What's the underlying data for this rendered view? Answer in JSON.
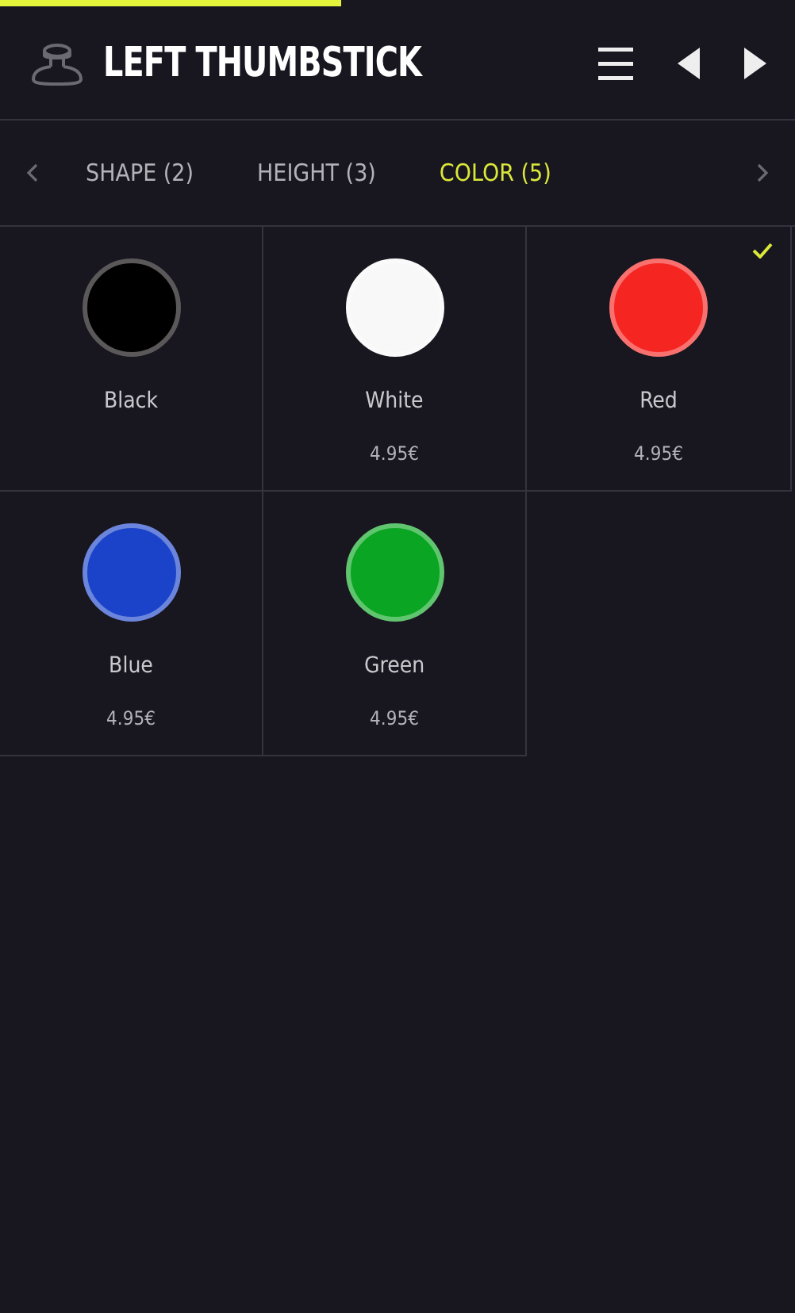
{
  "progress": {
    "level": 0.43
  },
  "header": {
    "title": "LEFT THUMBSTICK"
  },
  "tabs": [
    {
      "label": "SHAPE (2)",
      "selected": false
    },
    {
      "label": "HEIGHT (3)",
      "selected": false
    },
    {
      "label": "COLOR (5)",
      "selected": true
    }
  ],
  "swatches": [
    {
      "name": "Black",
      "color": "#000000",
      "selected": false
    },
    {
      "name": "White",
      "color": "#f8f8f8",
      "price": "4.95€",
      "selected": false
    },
    {
      "name": "Red",
      "color": "#f52522",
      "price": "4.95€",
      "selected": true
    },
    {
      "name": "Blue",
      "color": "#1b43c9",
      "price": "4.95€",
      "selected": false
    },
    {
      "name": "Green",
      "color": "#0aa522",
      "price": "4.95€",
      "selected": false
    }
  ]
}
